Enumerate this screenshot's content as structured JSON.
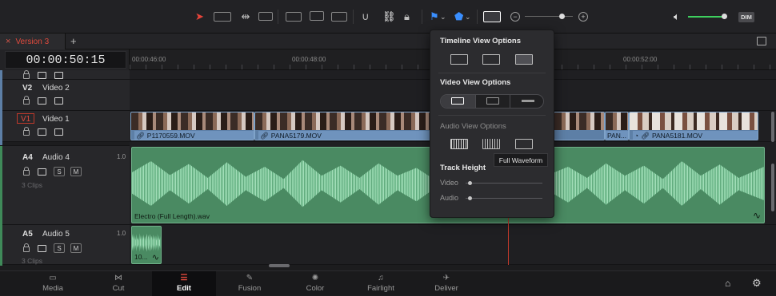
{
  "toolbar": {
    "dim_label": "DIM",
    "icons": [
      "selection-arrow-icon",
      "trim-edit-icon",
      "dynamic-trim-icon",
      "blade-icon",
      "insert-clip-icon",
      "overwrite-clip-icon",
      "replace-clip-icon",
      "snapping-icon",
      "linked-selection-icon",
      "position-lock-icon",
      "flag-icon",
      "marker-icon",
      "timeline-view-options-icon",
      "zoom-out-icon",
      "zoom-in-icon",
      "speaker-icon"
    ],
    "accent_color": "#e8443a"
  },
  "tabbar": {
    "close_glyph": "×",
    "tab_label": "Version 3",
    "add_glyph": "+"
  },
  "timecode": "00:00:50:15",
  "ruler": {
    "labels": [
      "00:00:46:00",
      "00:00:48:00",
      "00:00:52:00"
    ]
  },
  "tracks": {
    "v2": {
      "code": "V2",
      "name": "Video 2"
    },
    "v1": {
      "code": "V1",
      "name": "Video 1"
    },
    "a4": {
      "code": "A4",
      "name": "Audio 4",
      "level": "1.0",
      "clips": "3 Clips",
      "solo": "S",
      "mute": "M"
    },
    "a5": {
      "code": "A5",
      "name": "Audio 5",
      "level": "1.0",
      "clips": "3 Clips",
      "solo": "S",
      "mute": "M"
    }
  },
  "clips": {
    "video": [
      "P1170559.MOV",
      "PANA5179.MOV",
      "PAN...",
      "PANA5181.MOV"
    ],
    "audio_main": "Electro (Full Length).wav",
    "audio_small": "10..."
  },
  "popup": {
    "timeline_title": "Timeline View Options",
    "video_title": "Video View Options",
    "audio_title": "Audio View Options",
    "height_title": "Track Height",
    "video_label": "Video",
    "audio_label": "Audio",
    "video_height": 0.05,
    "audio_height": 0.05
  },
  "tooltip": "Full Waveform",
  "pages": [
    {
      "label": "Media",
      "icon": "media-icon"
    },
    {
      "label": "Cut",
      "icon": "cut-icon"
    },
    {
      "label": "Edit",
      "icon": "edit-icon"
    },
    {
      "label": "Fusion",
      "icon": "fusion-icon"
    },
    {
      "label": "Color",
      "icon": "color-icon"
    },
    {
      "label": "Fairlight",
      "icon": "fairlight-icon"
    },
    {
      "label": "Deliver",
      "icon": "deliver-icon"
    }
  ],
  "colors": {
    "video_clip": "#5d7fa6",
    "audio_clip": "#4a8a62",
    "playhead": "#c0392b",
    "volume": "#3ecf5e"
  }
}
